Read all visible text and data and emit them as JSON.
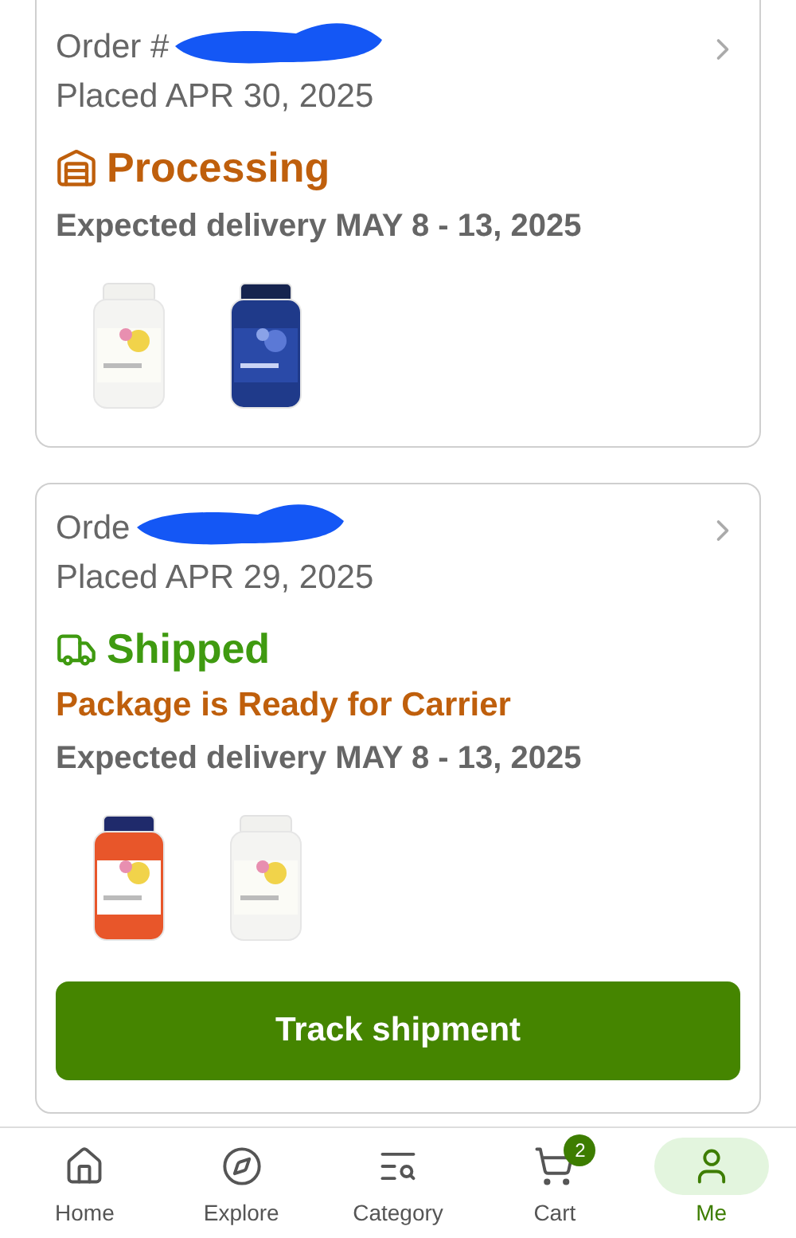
{
  "orders": [
    {
      "order_label": "Order #",
      "placed": "Placed APR 30, 2025",
      "status": {
        "kind": "processing",
        "label": "Processing"
      },
      "expected": "Expected delivery MAY 8 - 13, 2025"
    },
    {
      "order_label": "Orde",
      "placed": "Placed APR 29, 2025",
      "status": {
        "kind": "shipped",
        "label": "Shipped"
      },
      "note": "Package is Ready for Carrier",
      "expected": "Expected delivery MAY 8 - 13, 2025",
      "action": "Track shipment"
    }
  ],
  "nav": [
    {
      "kind": "home",
      "label": "Home",
      "selected": false
    },
    {
      "kind": "explore",
      "label": "Explore",
      "selected": false
    },
    {
      "kind": "category",
      "label": "Category",
      "selected": false
    },
    {
      "kind": "cart",
      "label": "Cart",
      "selected": false,
      "badge": "2"
    },
    {
      "kind": "me",
      "label": "Me",
      "selected": true
    }
  ]
}
